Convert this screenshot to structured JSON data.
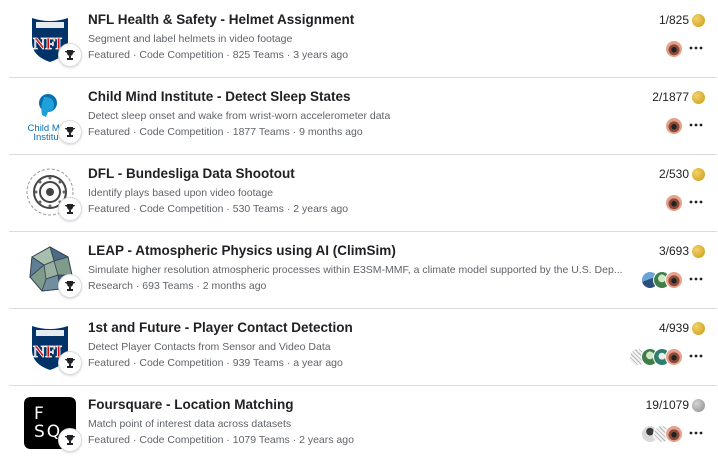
{
  "competitions": [
    {
      "title": "NFL Health & Safety - Helmet Assignment",
      "subtitle": "Segment and label helmets in video footage",
      "meta": "Featured · Code Competition · 825 Teams · 3 years ago",
      "rank": "1/825",
      "medal": "gold",
      "thumb_icon": "nfl-logo-icon",
      "team_avatars": [
        "avatar-eye-icon"
      ]
    },
    {
      "title": "Child Mind Institute - Detect Sleep States",
      "subtitle": "Detect sleep onset and wake from wrist-worn accelerometer data",
      "meta": "Featured · Code Competition · 1877 Teams · 9 months ago",
      "rank": "2/1877",
      "medal": "gold",
      "thumb_icon": "child-mind-institute-logo-icon",
      "thumb_text": "Child Mind Institu",
      "team_avatars": [
        "avatar-eye-icon"
      ]
    },
    {
      "title": "DFL - Bundesliga Data Shootout",
      "subtitle": "Identify plays based upon video footage",
      "meta": "Featured · Code Competition · 530 Teams · 2 years ago",
      "rank": "2/530",
      "medal": "gold",
      "thumb_icon": "dfl-circle-logo-icon",
      "team_avatars": [
        "avatar-eye-icon"
      ]
    },
    {
      "title": "LEAP - Atmospheric Physics using AI (ClimSim)",
      "subtitle": "Simulate higher resolution atmospheric processes within E3SM-MMF, a climate model supported by the U.S. Dep...",
      "meta": "Research · 693 Teams · 2 months ago",
      "rank": "3/693",
      "medal": "gold",
      "thumb_icon": "globe-mesh-icon",
      "team_avatars": [
        "avatar-eye-icon",
        "avatar-green-icon",
        "avatar-blue-icon"
      ]
    },
    {
      "title": "1st and Future - Player Contact Detection",
      "subtitle": "Detect Player Contacts from Sensor and Video Data",
      "meta": "Featured · Code Competition · 939 Teams · a year ago",
      "rank": "4/939",
      "medal": "gold",
      "thumb_icon": "nfl-logo-icon",
      "team_avatars": [
        "avatar-eye-icon",
        "avatar-teal-icon",
        "avatar-green-icon",
        "avatar-sketch-icon"
      ]
    },
    {
      "title": "Foursquare - Location Matching",
      "subtitle": "Match point of interest data across datasets",
      "meta": "Featured · Code Competition · 1079 Teams · 2 years ago",
      "rank": "19/1079",
      "medal": "silver",
      "thumb_icon": "foursquare-logo-icon",
      "thumb_text_top": "F",
      "thumb_text_bottom": "SQ",
      "team_avatars": [
        "avatar-eye-icon",
        "avatar-sketch-icon",
        "avatar-person-icon"
      ]
    }
  ],
  "colors": {
    "gold_medal": "#d4a017",
    "silver_medal": "#a0a0a0",
    "nfl_blue": "#013369",
    "nfl_red": "#d50a0a",
    "divider": "#dadce0"
  }
}
